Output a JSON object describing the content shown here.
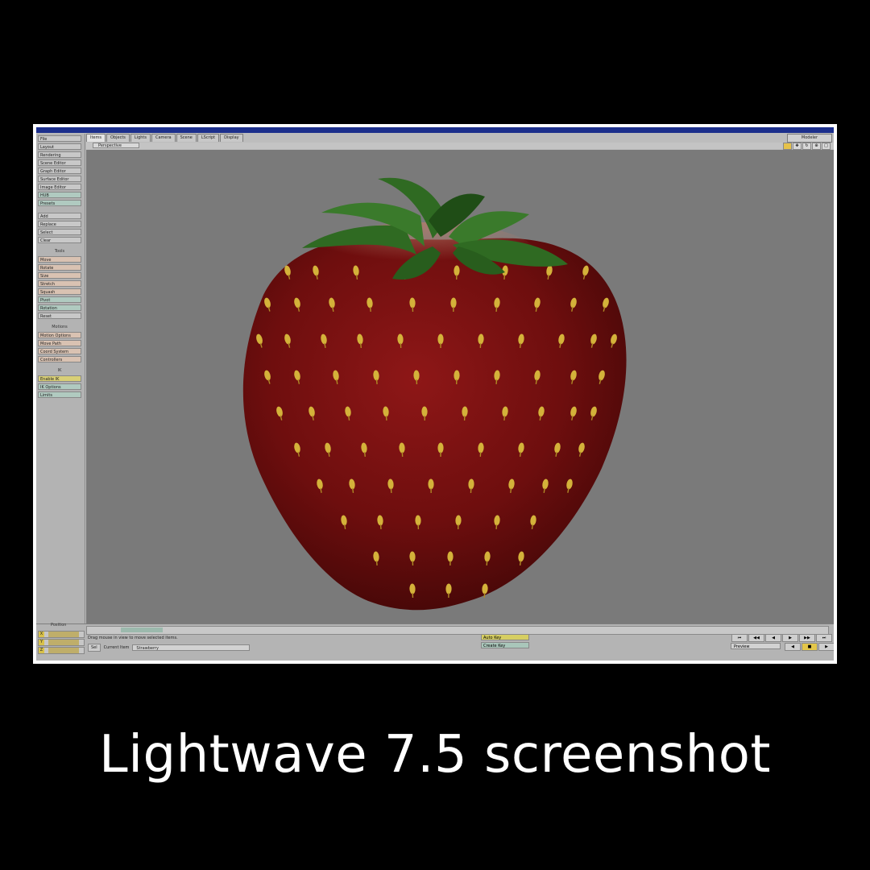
{
  "caption": "Lightwave 7.5 screenshot",
  "window": {
    "title": "",
    "tabs": [
      "Items",
      "Objects",
      "Lights",
      "Camera",
      "Scene",
      "LScript",
      "Display"
    ],
    "mode_button": "Modeler"
  },
  "sidebar": {
    "group1": [
      "File",
      "Layout",
      "Rendering",
      "Scene Editor",
      "Graph Editor",
      "Surface Editor",
      "Image Editor",
      "HUB",
      "Presets"
    ],
    "group2": [
      "Add",
      "Replace",
      "Select",
      "Clear"
    ],
    "tools_heading": "Tools",
    "tools": [
      "Move",
      "Rotate",
      "Size",
      "Stretch",
      "Squash",
      "Pivot",
      "Rotation",
      "Reset"
    ],
    "motions_heading": "Motions",
    "motions": [
      "Motion Options",
      "Move Path",
      "Coord System",
      "Controllers"
    ],
    "ik_heading": "IK",
    "ik": [
      "Enable IK",
      "IK Options",
      "Limits"
    ]
  },
  "viewport": {
    "view_mode": "Perspective"
  },
  "bottom": {
    "position_label": "Position",
    "coords": [
      {
        "axis": "X",
        "value": ""
      },
      {
        "axis": "Y",
        "value": ""
      },
      {
        "axis": "Z",
        "value": ""
      }
    ],
    "status_text": "Drag mouse in view to move selected items.",
    "sel_label": "Sel",
    "current_item_label": "Current Item",
    "current_item_value": "Strawberry",
    "auto_key": "Auto Key",
    "create_key": "Create Key",
    "preview": "Preview"
  },
  "colors": {
    "viewport_bg": "#7a7a7a",
    "berry_red": "#6e0e0e",
    "seed_yellow": "#d4b23a",
    "leaf_green": "#2f6a22",
    "titlebar_blue": "#1c2f8c"
  }
}
